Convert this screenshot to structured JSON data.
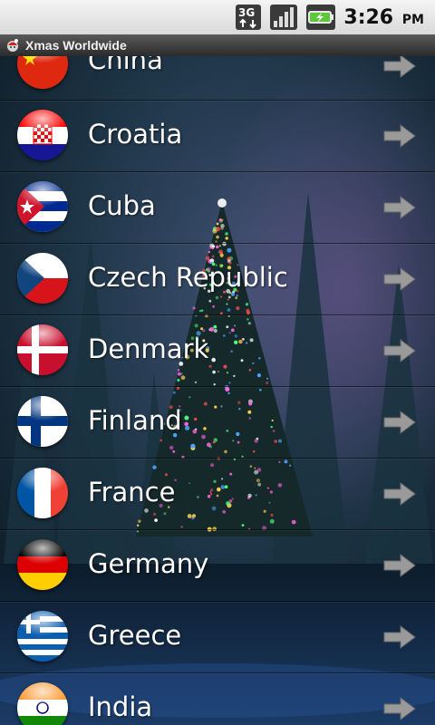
{
  "status_bar": {
    "network": "3G",
    "time": "3:26",
    "ampm": "PM"
  },
  "app": {
    "title": "Xmas Worldwide"
  },
  "countries": [
    {
      "name": "China",
      "flag": "china"
    },
    {
      "name": "Croatia",
      "flag": "croatia"
    },
    {
      "name": "Cuba",
      "flag": "cuba"
    },
    {
      "name": "Czech Republic",
      "flag": "czech"
    },
    {
      "name": "Denmark",
      "flag": "denmark"
    },
    {
      "name": "Finland",
      "flag": "finland"
    },
    {
      "name": "France",
      "flag": "france"
    },
    {
      "name": "Germany",
      "flag": "germany"
    },
    {
      "name": "Greece",
      "flag": "greece"
    },
    {
      "name": "India",
      "flag": "india"
    }
  ],
  "icons": {
    "row_action": "arrow-right-icon"
  }
}
